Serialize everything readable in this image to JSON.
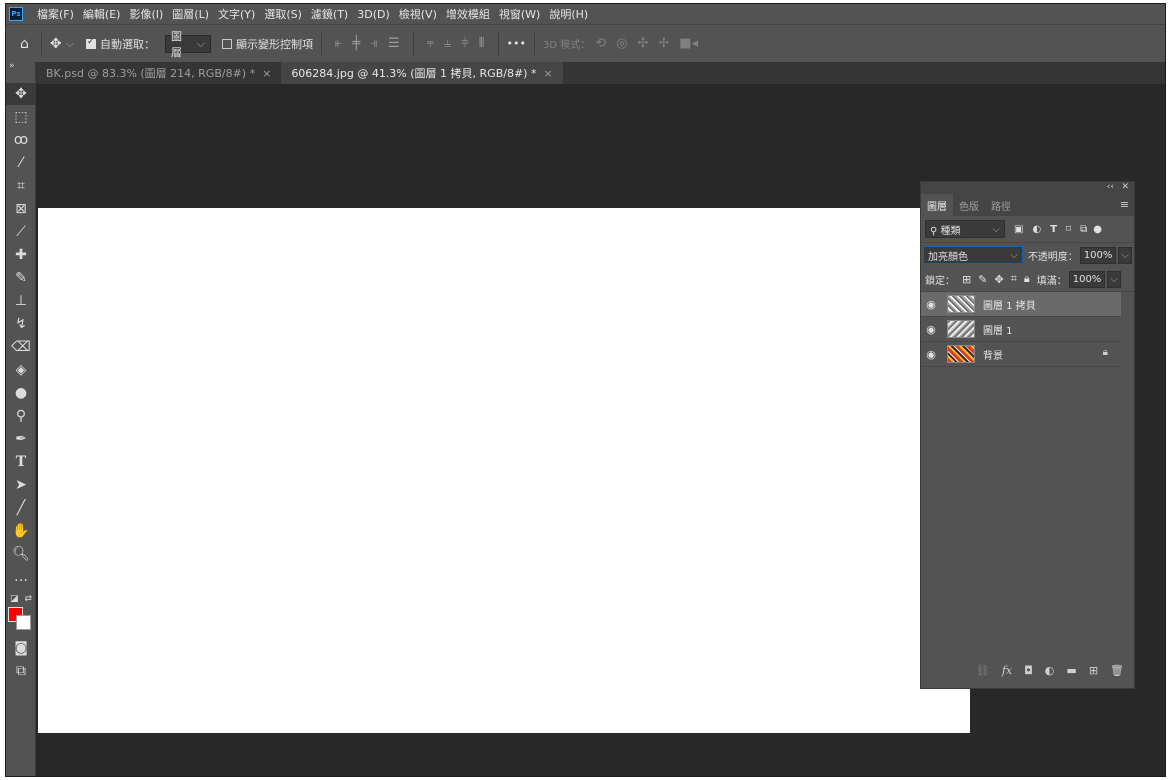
{
  "app": {
    "logo": "Ps"
  },
  "menu": [
    "檔案(F)",
    "編輯(E)",
    "影像(I)",
    "圖層(L)",
    "文字(Y)",
    "選取(S)",
    "濾鏡(T)",
    "3D(D)",
    "檢視(V)",
    "增效模組",
    "視窗(W)",
    "說明(H)"
  ],
  "options": {
    "home_icon": "home-icon",
    "move_icon": "move-icon",
    "auto_select_label": "自動選取：",
    "auto_select_checked": true,
    "auto_select_target": "圖層",
    "transform_label": "顯示變形控制項",
    "transform_checked": false,
    "more": "•••",
    "mode_3d_label": "3D 模式："
  },
  "tabs": [
    {
      "label": "BK.psd @ 83.3% (圖層 214, RGB/8#) *",
      "active": false
    },
    {
      "label": "606284.jpg @ 41.3% (圖層 1 拷貝, RGB/8#) *",
      "active": true
    }
  ],
  "colors": {
    "foreground": "#ff0000",
    "background": "#ffffff",
    "accent": "#31a8ff"
  },
  "layers_panel": {
    "tabs": [
      "圖層",
      "色版",
      "路徑"
    ],
    "filter_kind": "種類",
    "blend_mode": "加亮顏色",
    "opacity_label": "不透明度：",
    "opacity_value": "100%",
    "lock_label": "鎖定：",
    "fill_label": "填滿：",
    "fill_value": "100%",
    "layers": [
      {
        "name": "圖層 1 拷貝",
        "selected": true,
        "locked": false
      },
      {
        "name": "圖層 1",
        "selected": false,
        "locked": false
      },
      {
        "name": "背景",
        "selected": false,
        "locked": true
      }
    ]
  }
}
